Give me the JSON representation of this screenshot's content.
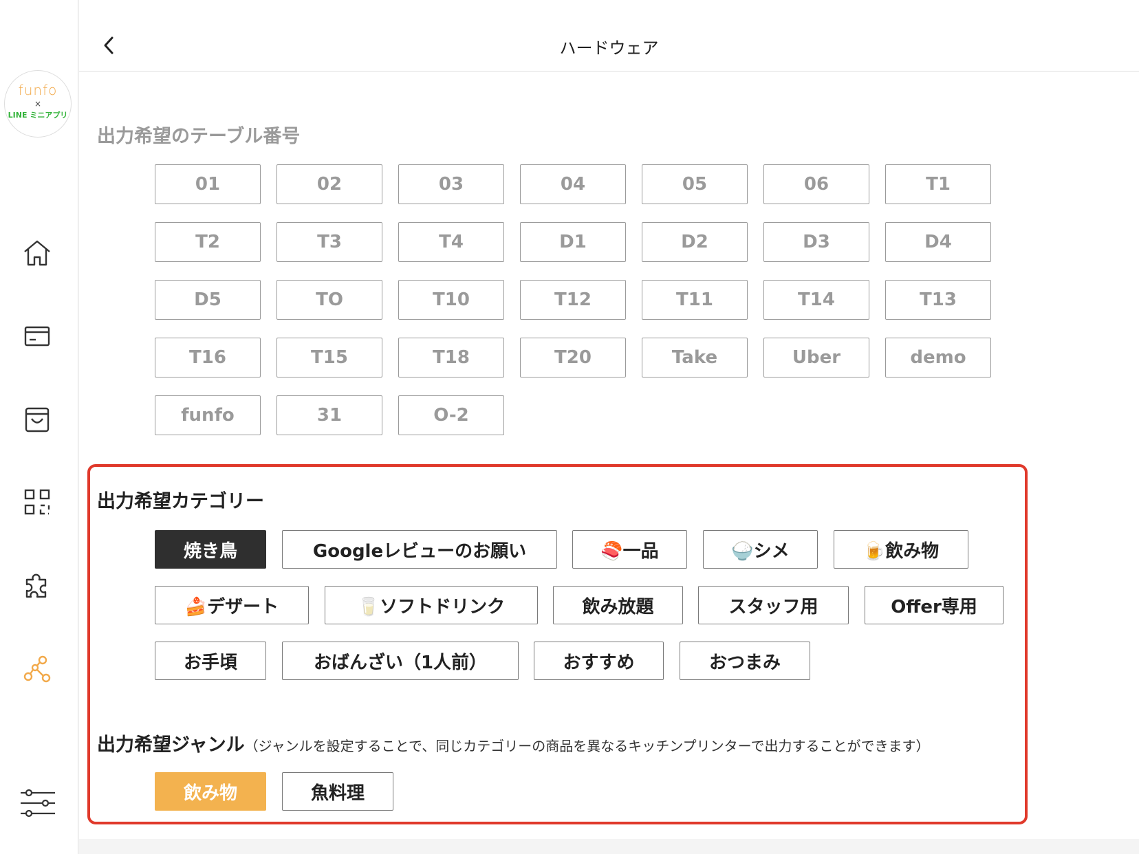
{
  "header": {
    "title": "ハードウェア"
  },
  "logo": {
    "line1": "funfo",
    "line2": "×",
    "line3": "LINE ミニアプリ"
  },
  "sidebar": {
    "icons": [
      "home-icon",
      "card-icon",
      "bag-icon",
      "qr-code-icon",
      "puzzle-icon",
      "network-icon",
      "sliders-icon"
    ],
    "active_color": "#f2a94a"
  },
  "tables": {
    "title": "出力希望のテーブル番号",
    "items": [
      "01",
      "02",
      "03",
      "04",
      "05",
      "06",
      "T1",
      "T2",
      "T3",
      "T4",
      "D1",
      "D2",
      "D3",
      "D4",
      "D5",
      "TO",
      "T10",
      "T12",
      "T11",
      "T14",
      "T13",
      "T16",
      "T15",
      "T18",
      "T20",
      "Take",
      "Uber",
      "demo",
      "funfo",
      "31",
      "O-2"
    ]
  },
  "categories": {
    "title": "出力希望カテゴリー",
    "items": [
      "焼き鳥",
      "Googleレビューのお願い",
      "🍣一品",
      "🍚シメ",
      "🍺飲み物",
      "🍰デザート",
      "🥛ソフトドリンク",
      "飲み放題",
      "スタッフ用",
      "Offer専用",
      "お手頃",
      "おばんざい（1人前）",
      "おすすめ",
      "おつまみ"
    ],
    "selected": "焼き鳥"
  },
  "genres": {
    "title": "出力希望ジャンル",
    "note": "（ジャンルを設定することで、同じカテゴリーの商品を異なるキッチンプリンターで出力することができます）",
    "items": [
      "飲み物",
      "魚料理"
    ],
    "selected": "飲み物"
  },
  "colors": {
    "highlight": "#e0392b",
    "selected_dark": "#2f2f2f",
    "selected_orange": "#f3b24f"
  }
}
